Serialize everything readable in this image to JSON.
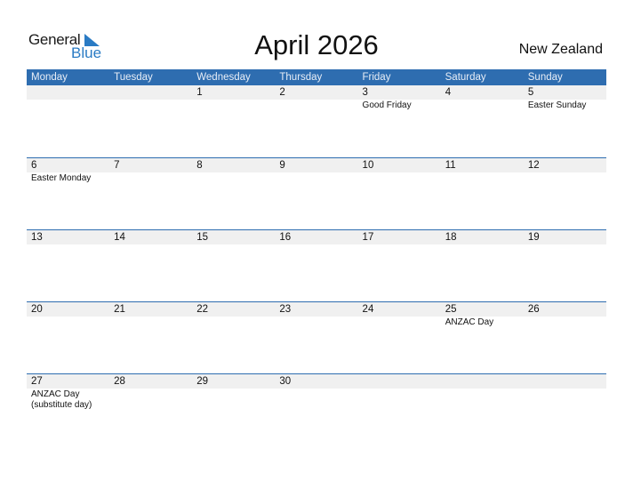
{
  "logo": {
    "line1": "General",
    "line2": "Blue",
    "accent": "#2a7bc4"
  },
  "title": "April 2026",
  "country": "New Zealand",
  "colors": {
    "header_bg": "#2e6db0",
    "date_band": "#f0f0f0"
  },
  "weekdays": [
    "Monday",
    "Tuesday",
    "Wednesday",
    "Thursday",
    "Friday",
    "Saturday",
    "Sunday"
  ],
  "weeks": [
    [
      {
        "d": ""
      },
      {
        "d": ""
      },
      {
        "d": "1"
      },
      {
        "d": "2"
      },
      {
        "d": "3",
        "h": "Good Friday"
      },
      {
        "d": "4"
      },
      {
        "d": "5",
        "h": "Easter Sunday"
      }
    ],
    [
      {
        "d": "6",
        "h": "Easter Monday"
      },
      {
        "d": "7"
      },
      {
        "d": "8"
      },
      {
        "d": "9"
      },
      {
        "d": "10"
      },
      {
        "d": "11"
      },
      {
        "d": "12"
      }
    ],
    [
      {
        "d": "13"
      },
      {
        "d": "14"
      },
      {
        "d": "15"
      },
      {
        "d": "16"
      },
      {
        "d": "17"
      },
      {
        "d": "18"
      },
      {
        "d": "19"
      }
    ],
    [
      {
        "d": "20"
      },
      {
        "d": "21"
      },
      {
        "d": "22"
      },
      {
        "d": "23"
      },
      {
        "d": "24"
      },
      {
        "d": "25",
        "h": "ANZAC Day"
      },
      {
        "d": "26"
      }
    ],
    [
      {
        "d": "27",
        "h": "ANZAC Day (substitute day)"
      },
      {
        "d": "28"
      },
      {
        "d": "29"
      },
      {
        "d": "30"
      },
      {
        "d": ""
      },
      {
        "d": ""
      },
      {
        "d": ""
      }
    ]
  ]
}
